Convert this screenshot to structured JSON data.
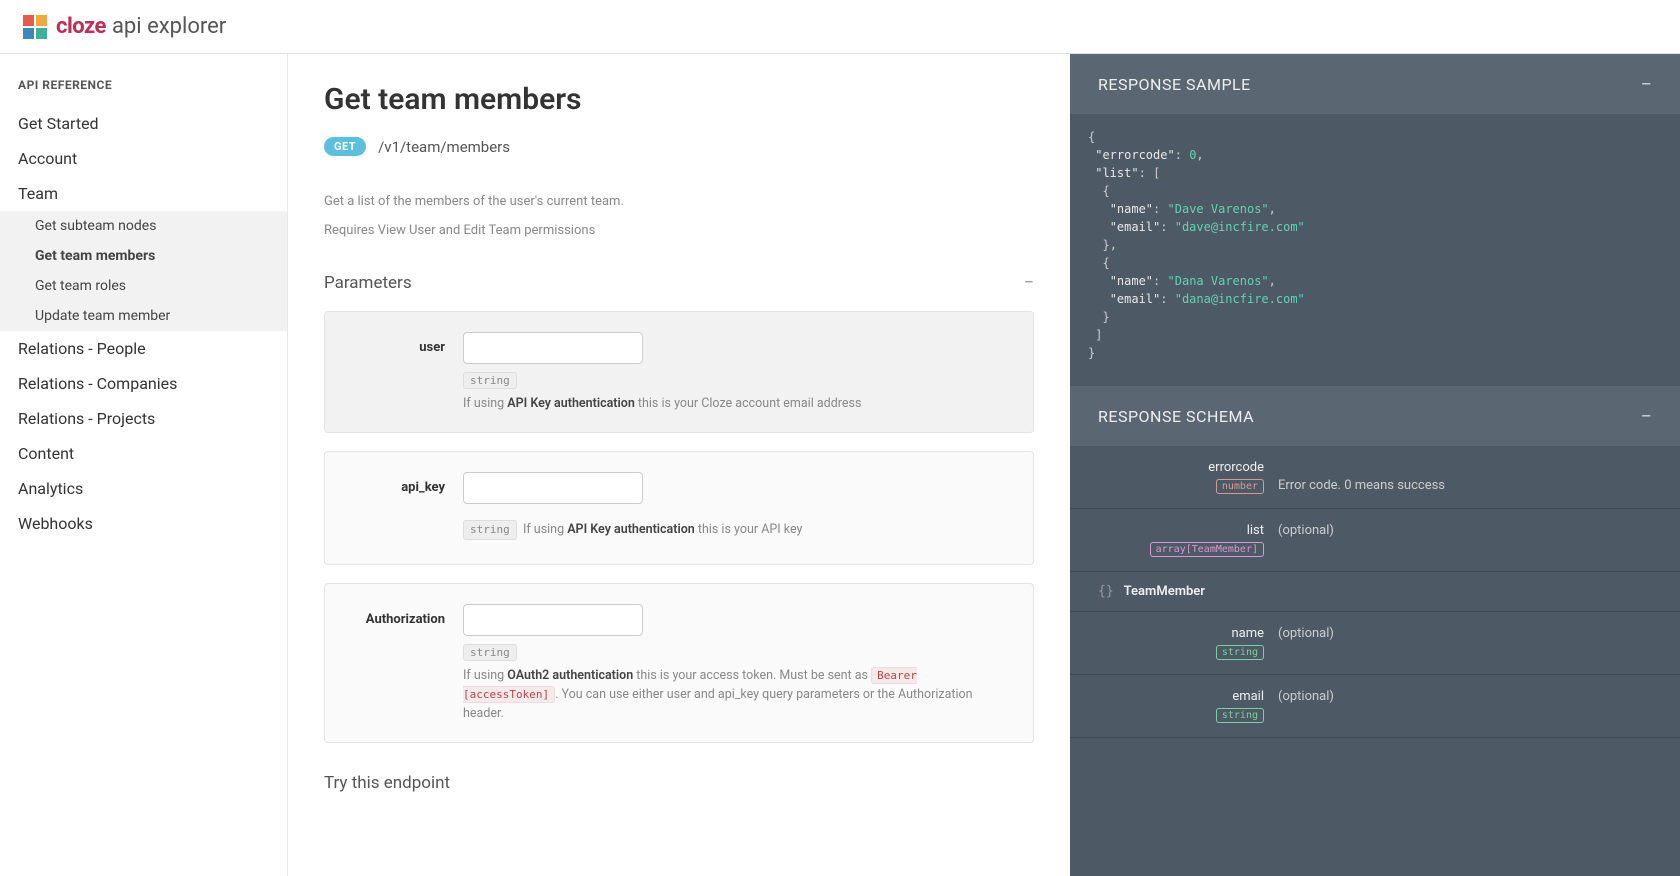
{
  "header": {
    "brand": "cloze",
    "sub": "api explorer"
  },
  "sidebar": {
    "heading": "API REFERENCE",
    "items": [
      "Get Started",
      "Account",
      "Team",
      "Relations - People",
      "Relations - Companies",
      "Relations - Projects",
      "Content",
      "Analytics",
      "Webhooks"
    ],
    "team_sub": [
      "Get subteam nodes",
      "Get team members",
      "Get team roles",
      "Update team member"
    ],
    "active_sub": "Get team members"
  },
  "page": {
    "title": "Get team members",
    "method": "GET",
    "path": "/v1/team/members",
    "desc1": "Get a list of the members of the user's current team.",
    "desc2": "Requires View User and Edit Team permissions",
    "parameters_heading": "Parameters",
    "try_heading": "Try this endpoint"
  },
  "params": {
    "user": {
      "label": "user",
      "type": "string",
      "desc_pre": "If using ",
      "desc_strong": "API Key authentication",
      "desc_post": " this is your Cloze account email address"
    },
    "api_key": {
      "label": "api_key",
      "type": "string",
      "desc_pre": "If using ",
      "desc_strong": "API Key authentication",
      "desc_post": " this is your API key"
    },
    "auth": {
      "label": "Authorization",
      "type": "string",
      "desc_pre": "If using ",
      "desc_strong": "OAuth2 authentication",
      "desc_mid": " this is your access token. Must be sent as ",
      "code": "Bearer [accessToken]",
      "desc_post": ". You can use either user and api_key query parameters or the Authorization header."
    }
  },
  "response_sample": {
    "heading": "RESPONSE SAMPLE",
    "data": {
      "errorcode": 0,
      "list": [
        {
          "name": "Dave Varenos",
          "email": "dave@incfire.com"
        },
        {
          "name": "Dana Varenos",
          "email": "dana@incfire.com"
        }
      ]
    }
  },
  "response_schema": {
    "heading": "RESPONSE SCHEMA",
    "rows": {
      "errorcode": {
        "name": "errorcode",
        "type": "number",
        "desc": "Error code. 0 means success"
      },
      "list": {
        "name": "list",
        "type": "array[TeamMember]",
        "desc": "(optional)"
      },
      "obj": "TeamMember",
      "name": {
        "name": "name",
        "type": "string",
        "desc": "(optional)"
      },
      "email": {
        "name": "email",
        "type": "string",
        "desc": "(optional)"
      }
    }
  }
}
